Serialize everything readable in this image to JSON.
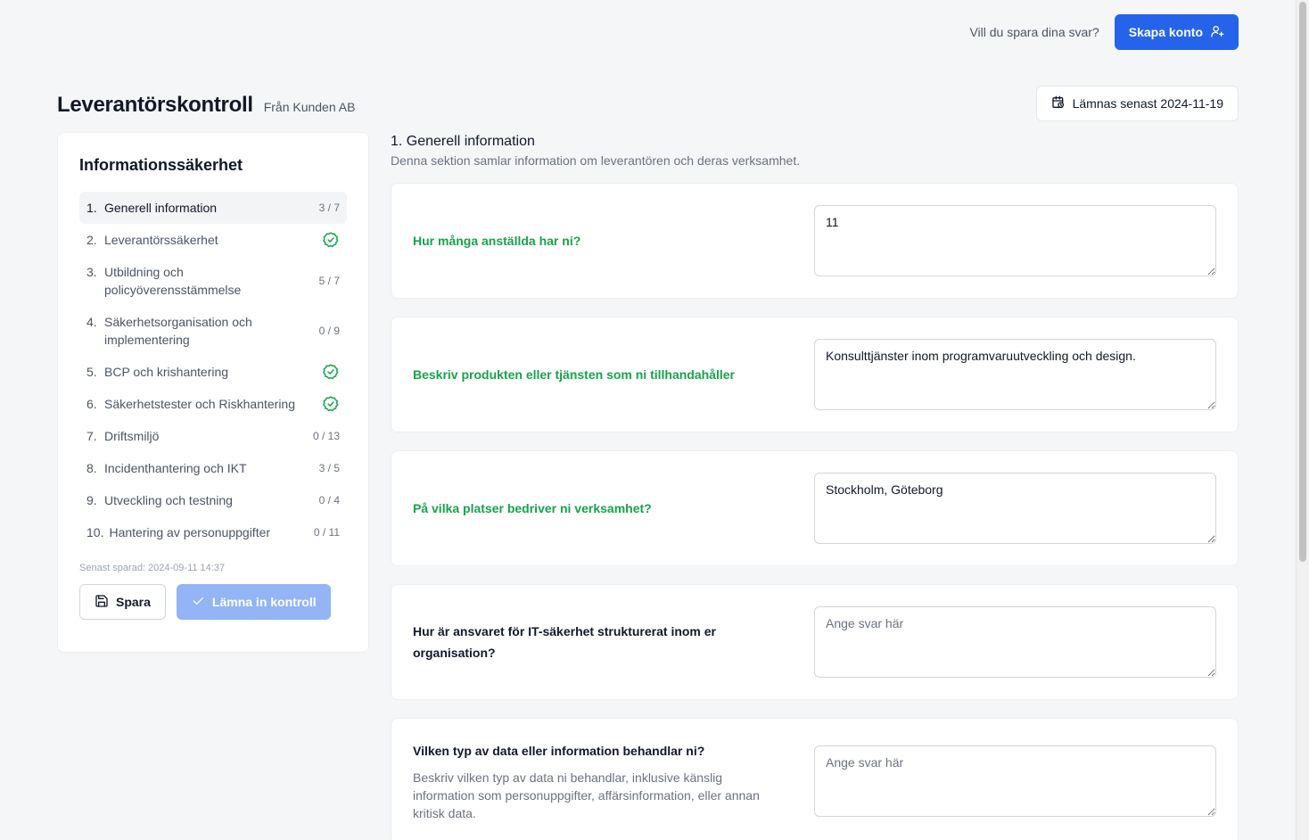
{
  "topbar": {
    "prompt": "Vill du spara dina svar?",
    "create_account": "Skapa konto"
  },
  "header": {
    "title": "Leverantörskontroll",
    "subtitle": "Från Kunden AB",
    "deadline": "Lämnas senast 2024-11-19"
  },
  "sidebar": {
    "title": "Informationssäkerhet",
    "items": [
      {
        "num": "1.",
        "label": "Generell information",
        "count": "3 / 7"
      },
      {
        "num": "2.",
        "label": "Leverantörssäkerhet",
        "count": ""
      },
      {
        "num": "3.",
        "label": "Utbildning och policyöverensstämmelse",
        "count": "5 / 7"
      },
      {
        "num": "4.",
        "label": "Säkerhetsorganisation och implementering",
        "count": "0 / 9"
      },
      {
        "num": "5.",
        "label": "BCP och krishantering",
        "count": ""
      },
      {
        "num": "6.",
        "label": "Säkerhetstester och Riskhantering",
        "count": ""
      },
      {
        "num": "7.",
        "label": "Driftsmiljö",
        "count": "0 / 13"
      },
      {
        "num": "8.",
        "label": "Incidenthantering och IKT",
        "count": "3 / 5"
      },
      {
        "num": "9.",
        "label": "Utveckling och testning",
        "count": "0 / 4"
      },
      {
        "num": "10.",
        "label": "Hantering av personuppgifter",
        "count": "0 / 11"
      }
    ],
    "saved": "Senast sparad: 2024-09-11 14:37",
    "save_label": "Spara",
    "submit_label": "Lämna in kontroll"
  },
  "main": {
    "section_title": "1. Generell information",
    "section_desc": "Denna sektion samlar information om leverantören och deras verksamhet.",
    "questions": [
      {
        "label": "Hur många anställda har ni?",
        "value": "11",
        "placeholder": "Ange svar här",
        "help": ""
      },
      {
        "label": "Beskriv produkten eller tjänsten som ni tillhandahåller",
        "value": "Konsulttjänster inom programvaruutveckling och design.",
        "placeholder": "Ange svar här",
        "help": ""
      },
      {
        "label": "På vilka platser bedriver ni verksamhet?",
        "value": "Stockholm, Göteborg",
        "placeholder": "Ange svar här",
        "help": ""
      },
      {
        "label": "Hur är ansvaret för IT-säkerhet strukturerat inom er organisation?",
        "value": "",
        "placeholder": "Ange svar här",
        "help": ""
      },
      {
        "label": "Vilken typ av data eller information behandlar ni?",
        "value": "",
        "placeholder": "Ange svar här",
        "help": "Beskriv vilken typ av data ni behandlar, inklusive känslig information som personuppgifter, affärsinformation, eller annan kritisk data."
      }
    ]
  },
  "colors": {
    "primary": "#2563eb",
    "answered": "#16a34a",
    "disabled": "#93b4f5"
  }
}
